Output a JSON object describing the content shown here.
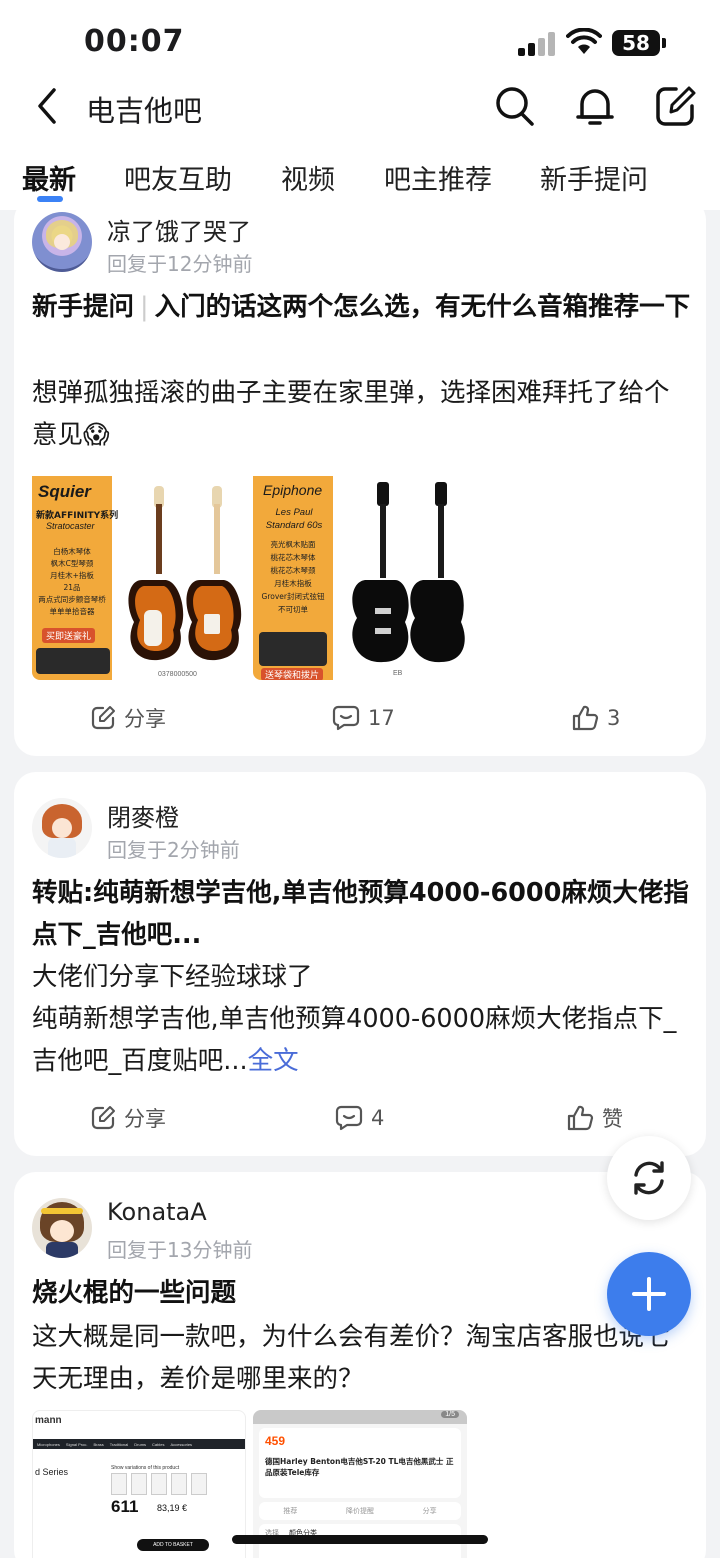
{
  "status": {
    "time": "00:07",
    "battery": "58"
  },
  "header": {
    "title": "电吉他吧"
  },
  "tabs": [
    "最新",
    "吧友互助",
    "视频",
    "吧主推荐",
    "新手提问"
  ],
  "posts": [
    {
      "user": "凉了饿了哭了",
      "time": "回复于12分钟前",
      "tag": "新手提问",
      "title": "入门的话这两个怎么选，有无什么音箱推荐一下",
      "body": "想弹孤独摇滚的曲子主要在家里弹，选择困难拜托了给个意见😱",
      "images": [
        {
          "brand": "Squier",
          "series": "新款AFFINITY系列",
          "model": "Stratocaster",
          "specs": [
            "白杨木琴体",
            "枫木C型琴颈",
            "月桂木+指板",
            "21品",
            "两点式同步颤音琴桥",
            "单单单拾音器"
          ],
          "promo": "买即送豪礼",
          "code": "0378000500"
        },
        {
          "brand": "Epiphone",
          "model": "Les Paul Standard 60s",
          "specs": [
            "亮光枫木贴面",
            "桃花芯木琴体",
            "桃花芯木琴颈",
            "月桂木指板",
            "Grover封闭式弦钮",
            "不可切单"
          ],
          "promo": "送琴袋和拨片",
          "code": "EB"
        }
      ],
      "share": "分享",
      "comments": "17",
      "likes": "3"
    },
    {
      "user": "閉麥橙",
      "time": "回复于2分钟前",
      "title": "转贴:纯萌新想学吉他,单吉他预算4000-6000麻烦大佬指点下_吉他吧...",
      "body": "大佬们分享下经验球球了\n纯萌新想学吉他,单吉他预算4000-6000麻烦大佬指点下_吉他吧_百度贴吧...",
      "more": "全文",
      "share": "分享",
      "comments": "4",
      "likes": "赞"
    },
    {
      "user": "KonataA",
      "time": "回复于13分钟前",
      "title": "烧火棍的一些问题",
      "body": "这大概是同一款吧，为什么会有差价？淘宝店客服也说七天无理由，差价是哪里来的？",
      "images": [
        {
          "site": "mann",
          "nav": [
            "Microphones",
            "Signal Proc.",
            "Brass",
            "Traditional",
            "Drums",
            "Cables",
            "Accessories"
          ],
          "series": "d Series",
          "label": "Show variations of this product",
          "price": "611",
          "eur": "83,19 €",
          "button": "ADD TO BASKET"
        },
        {
          "badge": "1/5",
          "price": "459",
          "desc": "德国Harley Benton电吉他ST-20 TL电吉他黑武士 正品原装Tele库存",
          "acts": [
            "推荐",
            "降价提醒",
            "分享"
          ],
          "select": "选择",
          "color": "颜色分类"
        }
      ]
    }
  ],
  "colors": {
    "accent": "#3b82f6",
    "fab": "#3d7dec",
    "link": "#4a6cd8"
  }
}
